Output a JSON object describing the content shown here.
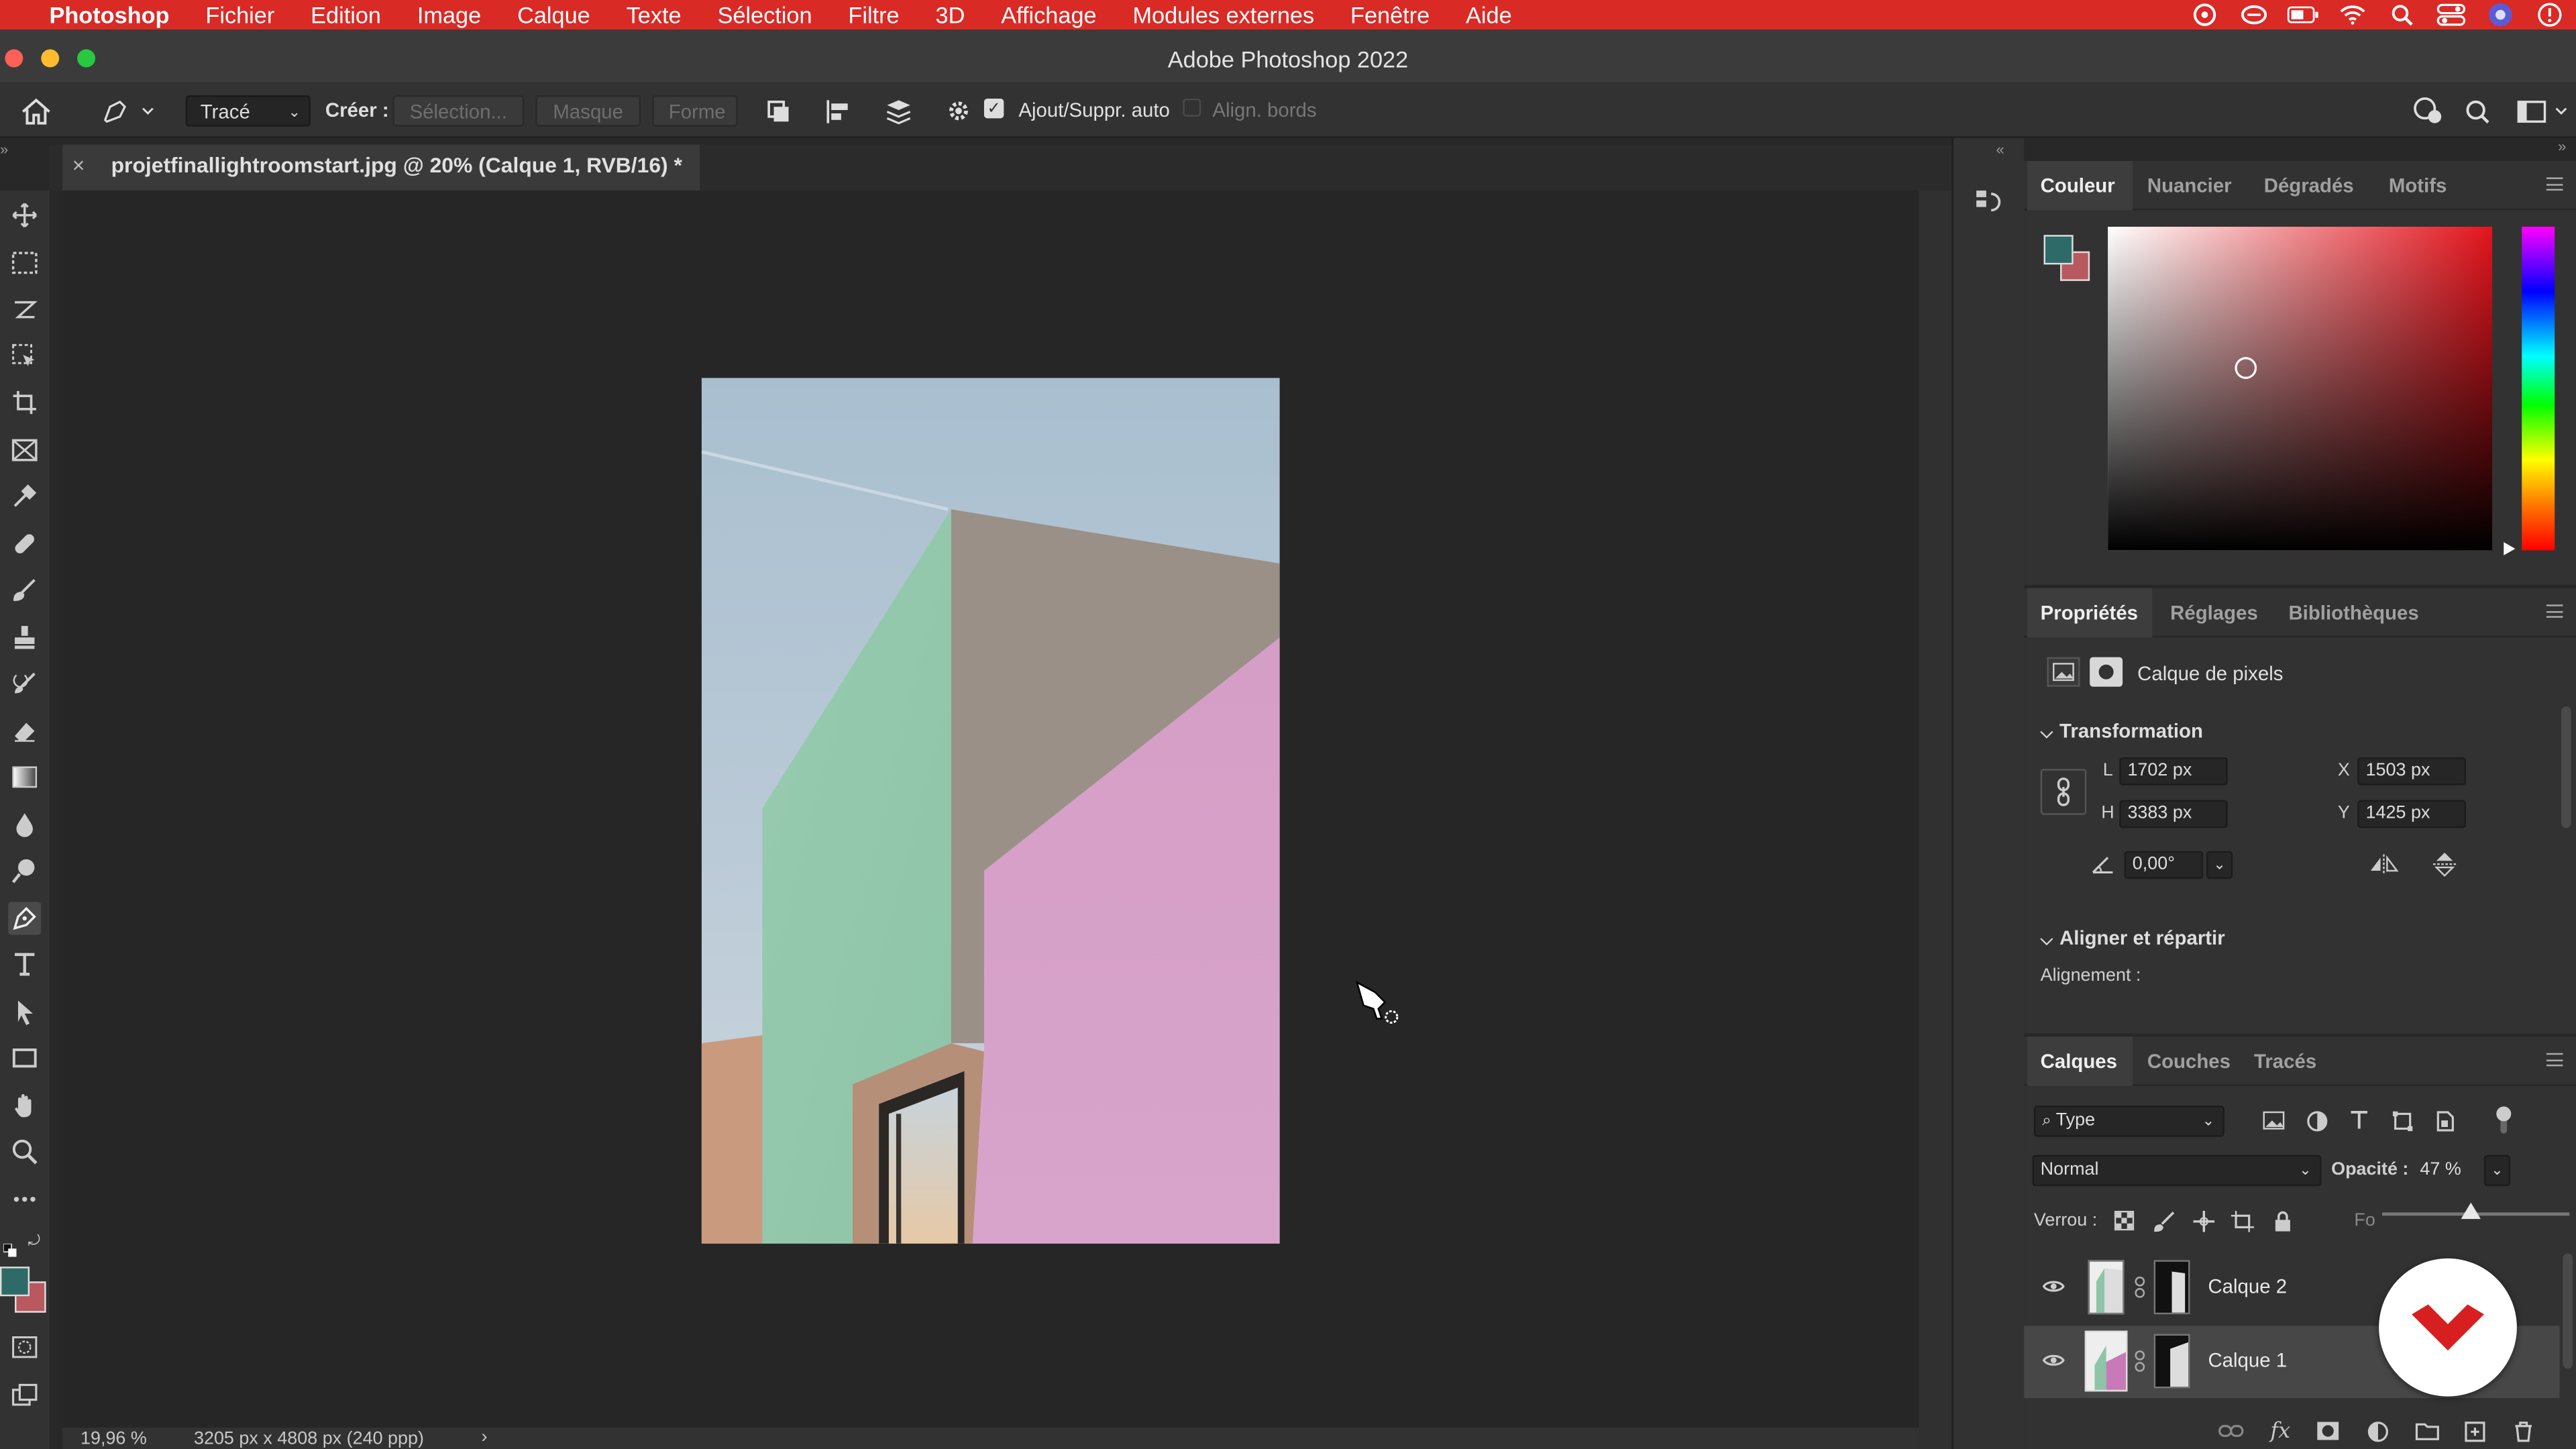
{
  "menubar": {
    "apple": "",
    "app": "Photoshop",
    "items": [
      "Fichier",
      "Edition",
      "Image",
      "Calque",
      "Texte",
      "Sélection",
      "Filtre",
      "3D",
      "Affichage",
      "Modules externes",
      "Fenêtre",
      "Aide"
    ]
  },
  "window": {
    "title": "Adobe Photoshop 2022"
  },
  "options": {
    "tool_mode": "Tracé",
    "create_label": "Créer :",
    "selection_btn": "Sélection...",
    "mask_btn": "Masque",
    "shape_btn": "Forme",
    "auto_add": "Ajout/Suppr. auto",
    "auto_add_checked": true,
    "align_edges": "Align. bords",
    "align_edges_checked": false
  },
  "document": {
    "tab_title": "projetfinallightroomstart.jpg @ 20% (Calque 1, RVB/16) *",
    "zoom": "19,96 %",
    "size_info": "3205 px x 4808 px (240 ppp)"
  },
  "color_panel": {
    "tabs": [
      "Couleur",
      "Nuancier",
      "Dégradés",
      "Motifs"
    ],
    "foreground": "#2e6b68",
    "background": "#b9585e",
    "hue_color": "#e4141c"
  },
  "properties_panel": {
    "tabs": [
      "Propriétés",
      "Réglages",
      "Bibliothèques"
    ],
    "type_label": "Calque de pixels",
    "transform_title": "Transformation",
    "w_label": "L",
    "w_value": "1702 px",
    "h_label": "H",
    "h_value": "3383 px",
    "x_label": "X",
    "x_value": "1503 px",
    "y_label": "Y",
    "y_value": "1425 px",
    "angle_value": "0,00°",
    "align_title": "Aligner et répartir",
    "align_label": "Alignement :"
  },
  "layers_panel": {
    "tabs": [
      "Calques",
      "Couches",
      "Tracés"
    ],
    "filter": "Type",
    "blend_mode": "Normal",
    "opacity_label": "Opacité :",
    "opacity_value": "47 %",
    "opacity_fraction": 0.47,
    "lock_label": "Verrou :",
    "fill_label": "Fo",
    "layers": [
      {
        "name": "Calque 2",
        "visible": true,
        "selected": false
      },
      {
        "name": "Calque 1",
        "visible": true,
        "selected": true
      }
    ]
  }
}
